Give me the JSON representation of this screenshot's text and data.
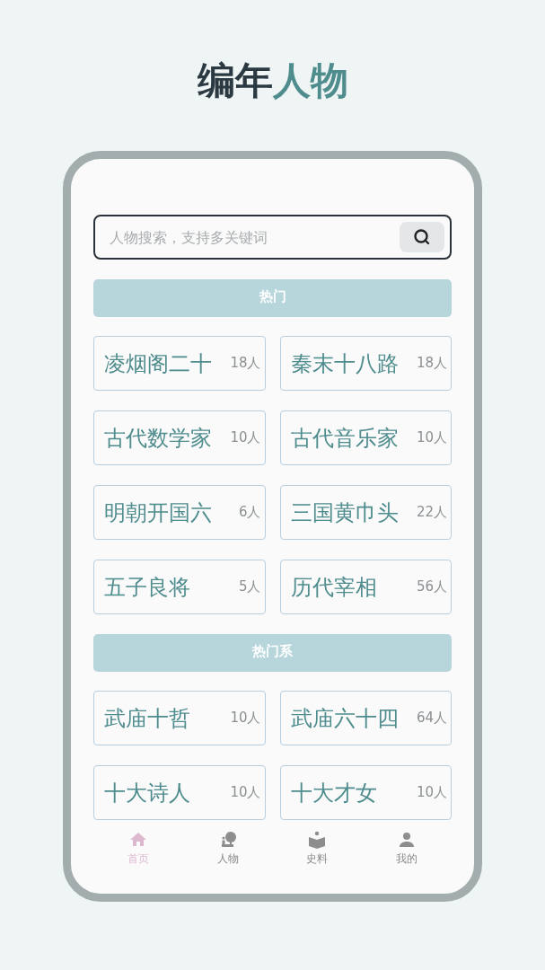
{
  "title": [
    {
      "text": "编年",
      "accent": false
    },
    {
      "text": "人物",
      "accent": true
    }
  ],
  "search": {
    "placeholder": "人物搜索，支持多关键词"
  },
  "sections": [
    {
      "heading": "热门",
      "cards": [
        {
          "name": "凌烟阁二十",
          "count": "18人"
        },
        {
          "name": "秦末十八路",
          "count": "18人"
        },
        {
          "name": "古代数学家",
          "count": "10人"
        },
        {
          "name": "古代音乐家",
          "count": "10人"
        },
        {
          "name": "明朝开国六",
          "count": "6人"
        },
        {
          "name": "三国黄巾头",
          "count": "22人"
        },
        {
          "name": "五子良将",
          "count": "5人"
        },
        {
          "name": "历代宰相",
          "count": "56人"
        }
      ]
    },
    {
      "heading": "热门系",
      "cards": [
        {
          "name": "武庙十哲",
          "count": "10人"
        },
        {
          "name": "武庙六十四",
          "count": "64人"
        },
        {
          "name": "十大诗人",
          "count": "10人"
        },
        {
          "name": "十大才女",
          "count": "10人"
        }
      ]
    }
  ],
  "nav": [
    {
      "label": "首页",
      "kind": "home",
      "selected": true
    },
    {
      "label": "人物",
      "kind": "person",
      "selected": false
    },
    {
      "label": "史料",
      "kind": "book",
      "selected": false
    },
    {
      "label": "我的",
      "kind": "user",
      "selected": false
    }
  ]
}
